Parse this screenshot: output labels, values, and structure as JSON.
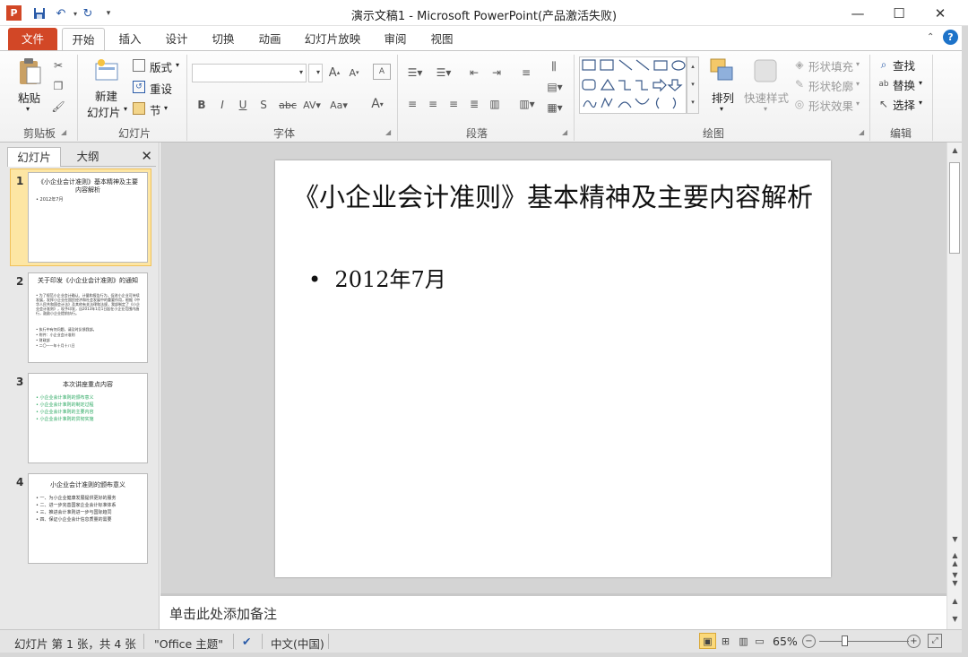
{
  "window": {
    "title": "演示文稿1 - Microsoft PowerPoint(产品激活失败)"
  },
  "tabs": [
    "文件",
    "开始",
    "插入",
    "设计",
    "切换",
    "动画",
    "幻灯片放映",
    "审阅",
    "视图"
  ],
  "ribbon": {
    "clipboard": {
      "paste": "粘贴",
      "label": "剪贴板"
    },
    "slides": {
      "new_slide_1": "新建",
      "new_slide_2": "幻灯片",
      "layout": "版式",
      "reset": "重设",
      "section": "节",
      "label": "幻灯片"
    },
    "font": {
      "label": "字体"
    },
    "paragraph": {
      "label": "段落"
    },
    "drawing": {
      "arrange": "排列",
      "quick_styles": "快速样式",
      "shape_fill": "形状填充",
      "shape_outline": "形状轮廓",
      "shape_effects": "形状效果",
      "label": "绘图"
    },
    "editing": {
      "find": "查找",
      "replace": "替换",
      "select": "选择",
      "label": "编辑"
    }
  },
  "pane": {
    "tab_slides": "幻灯片",
    "tab_outline": "大纲",
    "thumbs": [
      {
        "num": "1",
        "title": "《小企业会计准则》基本精神及主要内容解析",
        "lines": [
          "2012年7月"
        ]
      },
      {
        "num": "2",
        "title": "关于印发《小企业会计准则》的通知",
        "lines": [
          "为了规范小企业会计确认、计量和报告行为，促进小企业可持续发展，发挥小企业在国民经济和社会发展中的重要作用，根据《中华人民共和国会计法》及其他有关法律和法规，我部制定了《小企业会计准则》，现予印发，自2013年1月1日起在小企业范围内施行，鼓励小企业提前执行。",
          "执行中有何问题，请及时反馈我部。",
          "附件：小企业会计准则",
          "财政部",
          "二〇一一年十月十八日"
        ]
      },
      {
        "num": "3",
        "title": "本次讲座重点内容",
        "lines": [
          "小企业会计准则的颁布意义",
          "小企业会计准则的制定过程",
          "小企业会计准则的主要内容",
          "小企业会计准则的贯彻实施"
        ]
      },
      {
        "num": "4",
        "title": "小企业会计准则的颁布意义",
        "lines": [
          "一、为小企业健康发展提供更好的服务",
          "二、进一步完善国家企业会计标准体系",
          "三、推进会计准则进一步与国际趋同",
          "四、保证小企业会计信息质量的需要"
        ]
      }
    ]
  },
  "slide": {
    "title": "《小企业会计准则》基本精神及主要内容解析",
    "bullet": "2012年7月"
  },
  "notes": {
    "placeholder": "单击此处添加备注"
  },
  "status": {
    "slide_info": "幻灯片 第 1 张，共 4 张",
    "theme": "\"Office 主题\"",
    "language": "中文(中国)",
    "zoom": "65%"
  },
  "colors": {
    "file_tab": "#d24726",
    "thumb_selected": "#fde6a4",
    "accent": "#2a5ba8"
  }
}
